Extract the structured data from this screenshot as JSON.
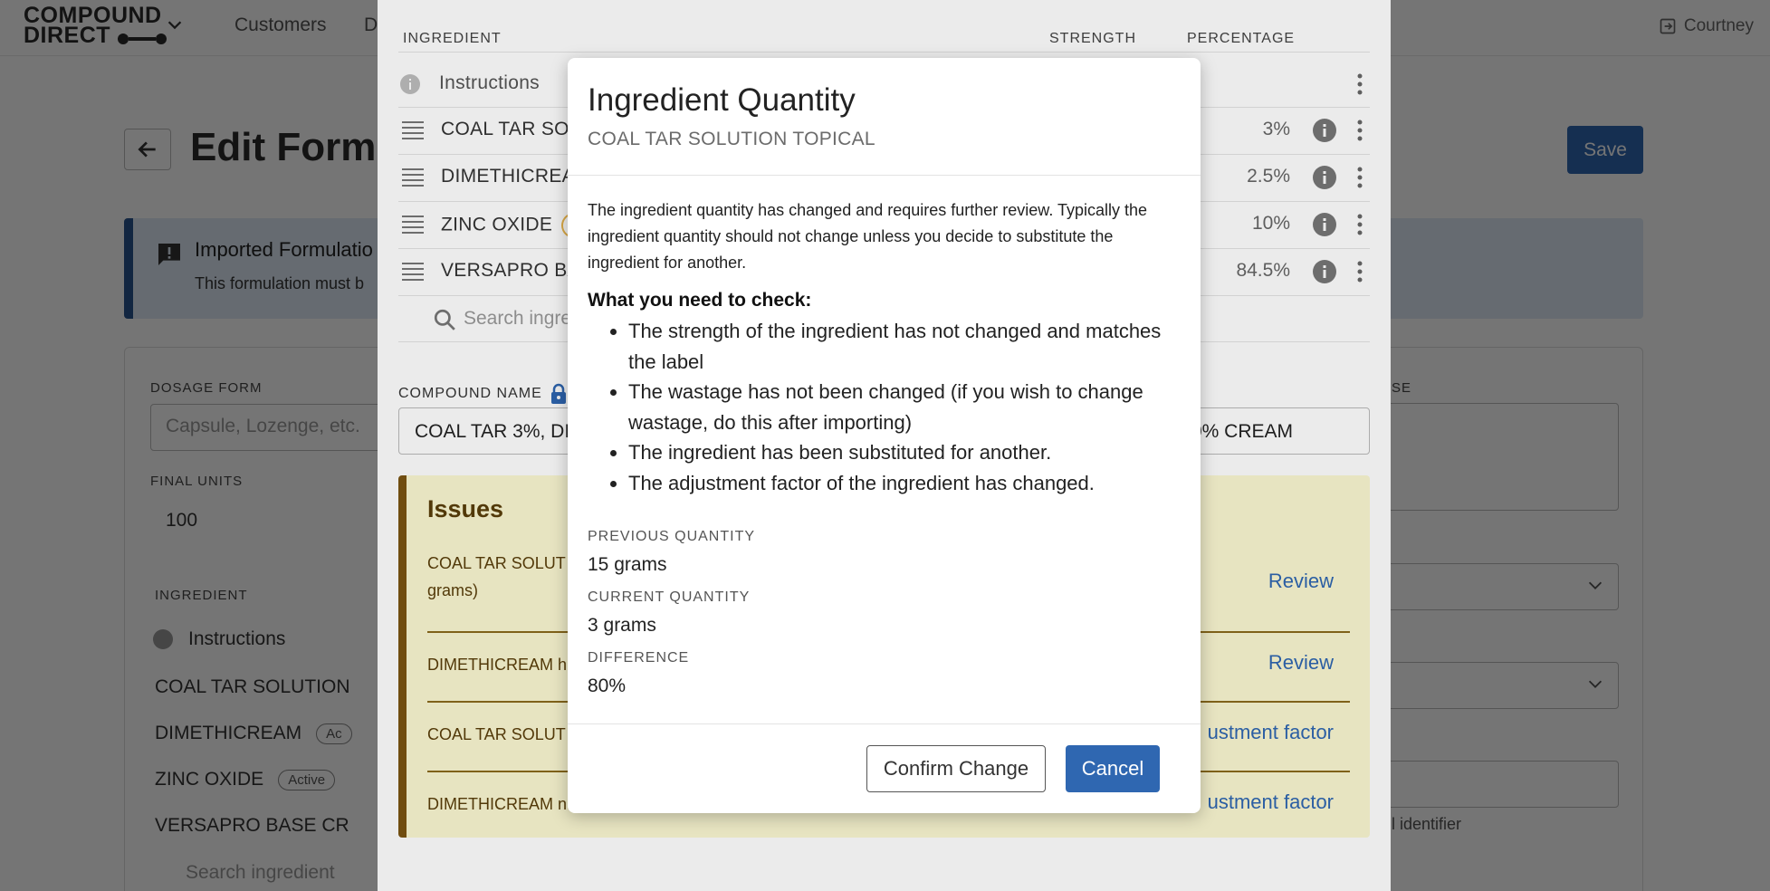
{
  "app": {
    "logo_line1": "COMPOUND",
    "logo_line2": "DIRECT",
    "nav": [
      "Customers",
      "D"
    ],
    "user_name": "Courtney"
  },
  "page": {
    "title": "Edit Formu",
    "save_label": "Save",
    "banner_title": "Imported Formulatio",
    "banner_text": "This formulation must b"
  },
  "form": {
    "dosage_form_label": "DOSAGE FORM",
    "dosage_form_placeholder": "Capsule, Lozenge, etc.",
    "final_units_label": "FINAL UNITS",
    "final_units_value": "100",
    "ingredient_label": "INGREDIENT",
    "bg_instructions": "Instructions",
    "bg_rows": [
      {
        "name": "COAL TAR SOLUTION",
        "badge": ""
      },
      {
        "name": "DIMETHICREAM",
        "badge": "Ac"
      },
      {
        "name": "ZINC OXIDE",
        "badge": "Active"
      },
      {
        "name": "VERSAPRO BASE CR",
        "badge": ""
      }
    ],
    "bg_search_placeholder": "Search ingredient",
    "right_label_fragment": "SE",
    "right_helper_fragment": "l identifier"
  },
  "panel": {
    "columns": {
      "ingredient": "INGREDIENT",
      "strength": "STRENGTH",
      "percentage": "PERCENTAGE"
    },
    "instructions_label": "Instructions",
    "rows": [
      {
        "name": "COAL TAR SOL",
        "percentage": "3%"
      },
      {
        "name": "DIMETHICREA",
        "percentage": "2.5%"
      },
      {
        "name": "ZINC OXIDE",
        "percentage": "10%"
      },
      {
        "name": "VERSAPRO BA",
        "percentage": "84.5%"
      }
    ],
    "search_placeholder": "Search ingre",
    "compound_name_label": "COMPOUND NAME",
    "compound_name_start": "COAL TAR 3%, DI",
    "compound_name_end": "0% CREAM",
    "issues_title": "Issues",
    "issues": [
      {
        "line1": "COAL TAR SOLUT",
        "line2": "grams)",
        "action": "Review"
      },
      {
        "line1": "DIMETHICREAM h",
        "line2": "",
        "action": "Review"
      },
      {
        "line1": "COAL TAR SOLUT",
        "line2": "",
        "action": "ustment factor"
      },
      {
        "line1": "DIMETHICREAM n",
        "line2": "",
        "action": "ustment factor"
      }
    ]
  },
  "modal": {
    "title": "Ingredient Quantity",
    "subtitle": "COAL TAR SOLUTION TOPICAL",
    "intro": "The ingredient quantity has changed and requires further review. Typically the ingredient quantity should not change unless you decide to substitute the ingredient for another.",
    "check_heading": "What you need to check:",
    "checks": [
      "The strength of the ingredient has not changed and matches the label",
      "The wastage has not been changed (if you wish to change wastage, do this after importing)",
      "The ingredient has been substituted for another.",
      "The adjustment factor of the ingredient has changed."
    ],
    "previous_quantity_label": "PREVIOUS QUANTITY",
    "previous_quantity": "15 grams",
    "current_quantity_label": "CURRENT QUANTITY",
    "current_quantity": "3 grams",
    "difference_label": "DIFFERENCE",
    "difference": "80%",
    "confirm_label": "Confirm Change",
    "cancel_label": "Cancel"
  },
  "colors": {
    "primary": "#2f67b1",
    "issues_bg": "#fbf8d2",
    "issues_border": "#7a5412",
    "banner_bg": "#dfeaf7"
  }
}
